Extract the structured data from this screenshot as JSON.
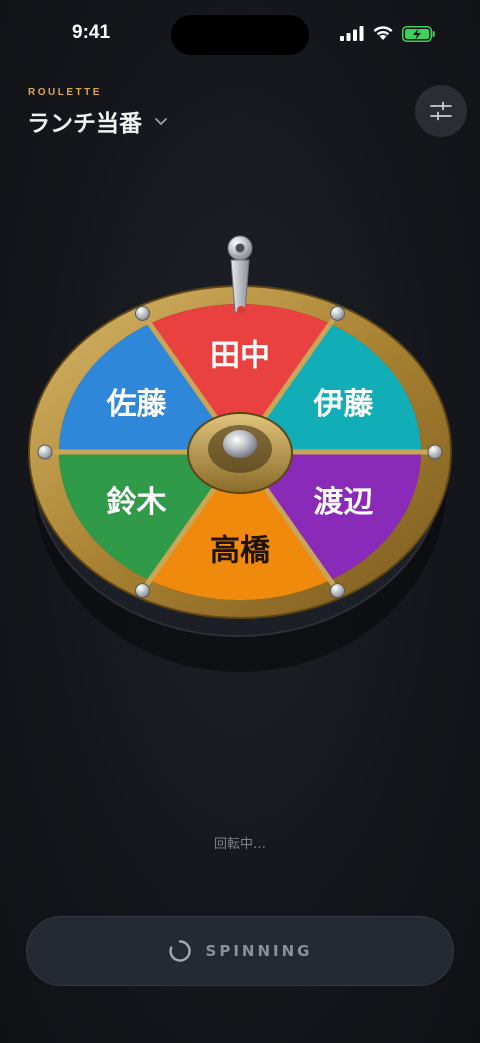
{
  "status_bar": {
    "time": "9:41"
  },
  "header": {
    "eyebrow": "ROULETTE",
    "title": "ランチ当番"
  },
  "wheel": {
    "segments": [
      {
        "label": "田中",
        "color": "#e8413f"
      },
      {
        "label": "伊藤",
        "color": "#12aeb8"
      },
      {
        "label": "渡辺",
        "color": "#8a2ab8"
      },
      {
        "label": "高橋",
        "color": "#f08a0c"
      },
      {
        "label": "鈴木",
        "color": "#2f9a48"
      },
      {
        "label": "佐藤",
        "color": "#2e87d8"
      }
    ],
    "rim_color": "#b8913f"
  },
  "status_text": "回転中…",
  "spin_button": {
    "label": "SPINNING"
  }
}
